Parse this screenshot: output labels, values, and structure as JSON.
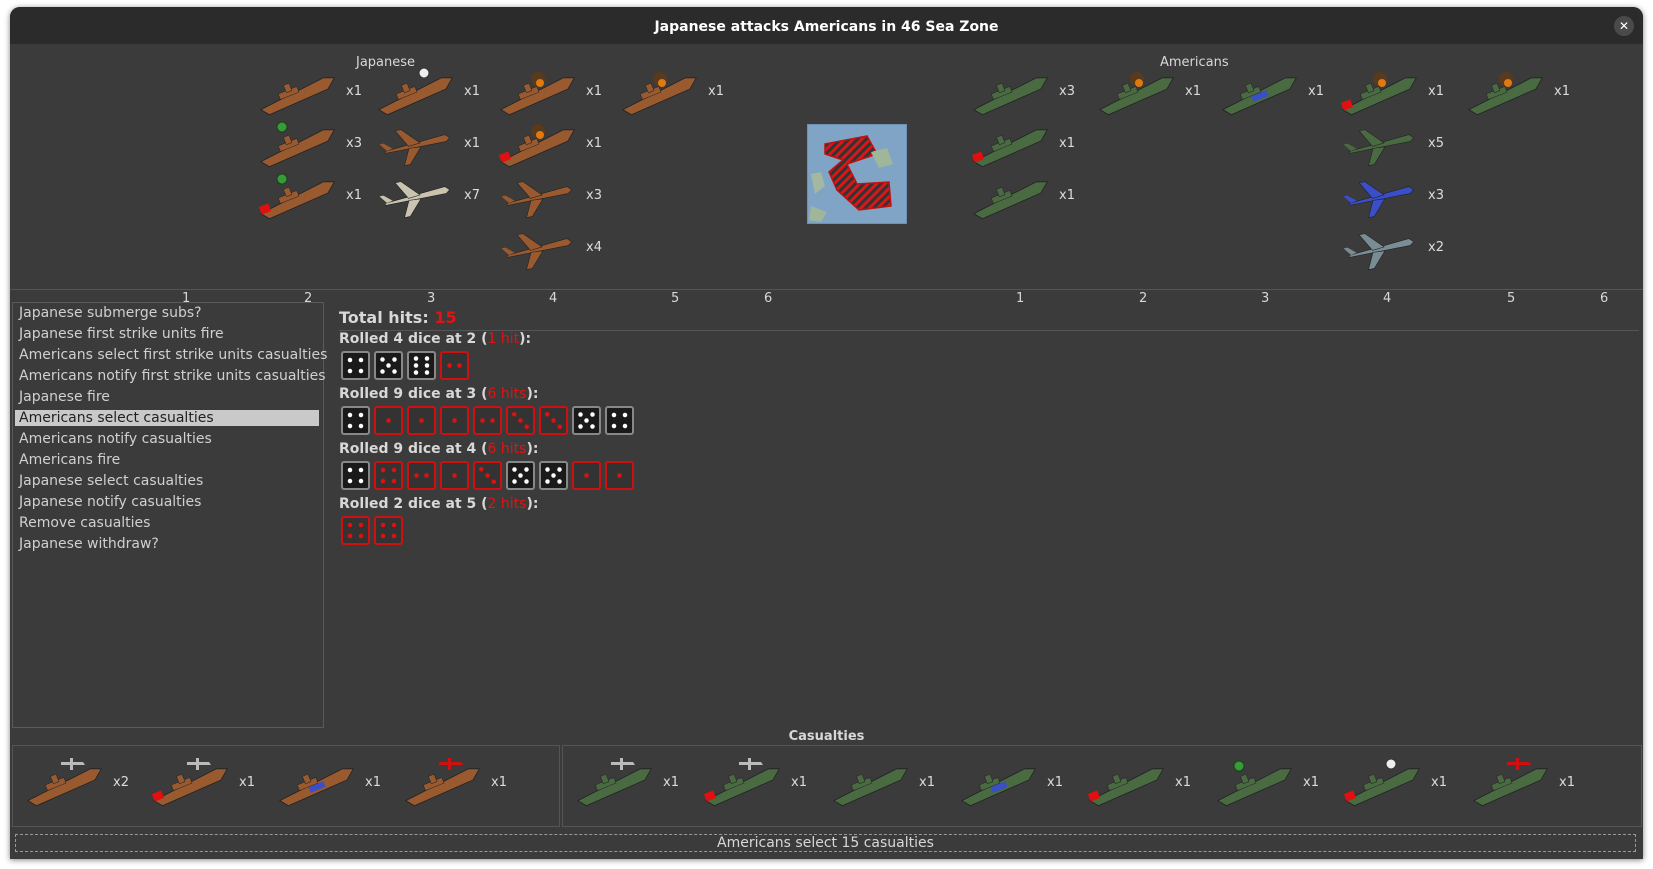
{
  "title": "Japanese attacks Americans in 46 Sea Zone",
  "close_label": "✕",
  "sides": {
    "attacker": "Japanese",
    "defender": "Americans"
  },
  "colors": {
    "japanese": "#9a5a30",
    "american": "#4a6a42",
    "american_dark": "#445a60",
    "hit_red": "#e81010",
    "american_plane_blue": "#3a4ec8"
  },
  "attacker_units": [
    {
      "kind": "carrier",
      "count": "x1"
    },
    {
      "kind": "battleship-green-dot",
      "count": "x3"
    },
    {
      "kind": "battleship-green-dot-damaged",
      "count": "x1"
    },
    {
      "kind": "transport-marker",
      "count": "x1"
    },
    {
      "kind": "zero-fighter",
      "count": "x1"
    },
    {
      "kind": "zero-fighter-light",
      "count": "x7"
    },
    {
      "kind": "cruiser-burning",
      "count": "x1"
    },
    {
      "kind": "cruiser-burning-damaged",
      "count": "x1"
    },
    {
      "kind": "bomber",
      "count": "x3"
    },
    {
      "kind": "dive-bomber",
      "count": "x4"
    },
    {
      "kind": "battleship-burning",
      "count": "x1"
    }
  ],
  "defender_units": [
    {
      "kind": "transport",
      "count": "x3"
    },
    {
      "kind": "destroyer-damaged",
      "count": "x1"
    },
    {
      "kind": "submarine",
      "count": "x1"
    },
    {
      "kind": "carrier-burning",
      "count": "x1"
    },
    {
      "kind": "sub-blue",
      "count": "x1"
    },
    {
      "kind": "cruiser-burning-damaged",
      "count": "x1"
    },
    {
      "kind": "fighter-green",
      "count": "x5"
    },
    {
      "kind": "fighter-blue",
      "count": "x3"
    },
    {
      "kind": "fighter-grey",
      "count": "x2"
    },
    {
      "kind": "battleship-burning",
      "count": "x1"
    }
  ],
  "columns_left": [
    "1",
    "2",
    "3",
    "4",
    "5",
    "6"
  ],
  "columns_right": [
    "1",
    "2",
    "3",
    "4",
    "5",
    "6"
  ],
  "steps": [
    "Japanese submerge subs?",
    "Japanese first strike units fire",
    "Americans select first strike units casualties",
    "Americans notify first strike units casualties",
    "Japanese fire",
    "Americans select casualties",
    "Americans notify casualties",
    "Americans fire",
    "Japanese select casualties",
    "Japanese notify casualties",
    "Remove casualties",
    "Japanese withdraw?"
  ],
  "selected_step": "Americans select casualties",
  "results": {
    "total_label": "Total hits:",
    "total_hits": "15",
    "rolls": [
      {
        "pre": "Rolled 4 dice at 2 (",
        "hits": "1 hit",
        "post": "):",
        "dice": [
          4,
          5,
          6,
          2
        ],
        "hit": [
          false,
          false,
          false,
          true
        ]
      },
      {
        "pre": "Rolled 9 dice at 3 (",
        "hits": "6 hits",
        "post": "):",
        "dice": [
          4,
          1,
          1,
          1,
          2,
          3,
          3,
          5,
          4
        ],
        "hit": [
          false,
          true,
          true,
          true,
          true,
          true,
          true,
          false,
          false
        ]
      },
      {
        "pre": "Rolled 9 dice at 4 (",
        "hits": "6 hits",
        "post": "):",
        "dice": [
          4,
          4,
          2,
          1,
          3,
          5,
          5,
          1,
          1
        ],
        "hit": [
          false,
          true,
          true,
          true,
          true,
          false,
          false,
          true,
          true
        ]
      },
      {
        "pre": "Rolled 2 dice at 5 (",
        "hits": "2 hits",
        "post": "):",
        "dice": [
          4,
          4
        ],
        "hit": [
          true,
          true
        ]
      }
    ]
  },
  "casualties_title": "Casualties",
  "japanese_casualties": [
    {
      "kind": "carrier-plane",
      "count": "x2"
    },
    {
      "kind": "carrier-plane-damaged",
      "count": "x1"
    },
    {
      "kind": "sub-blue",
      "count": "x1"
    },
    {
      "kind": "carrier-red-plane",
      "count": "x1"
    }
  ],
  "american_casualties": [
    {
      "kind": "carrier-plane",
      "count": "x1"
    },
    {
      "kind": "carrier-plane-damaged",
      "count": "x1"
    },
    {
      "kind": "submarine",
      "count": "x1"
    },
    {
      "kind": "sub-blue",
      "count": "x1"
    },
    {
      "kind": "destroyer-damaged",
      "count": "x1"
    },
    {
      "kind": "battleship-green-dot",
      "count": "x1"
    },
    {
      "kind": "transport-marker-damaged",
      "count": "x1"
    },
    {
      "kind": "carrier-red-plane",
      "count": "x1"
    }
  ],
  "status_text": "Americans select 15 casualties"
}
